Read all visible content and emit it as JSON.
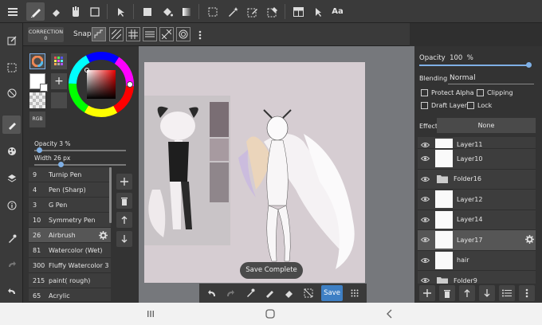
{
  "topbar": {
    "text_tool_label": "Aa"
  },
  "subbar": {
    "correction_label": "CORRECTION",
    "correction_value": "0",
    "snap_label": "Snap"
  },
  "leftpanel": {
    "rgb_label": "RGB",
    "opacity_label": "Opacity",
    "opacity_value": "3",
    "opacity_unit": "%",
    "opacity_fraction": 0.03,
    "width_label": "Width",
    "width_value": "26",
    "width_unit": "px",
    "width_fraction": 0.26,
    "brushes": [
      {
        "size": "9",
        "name": "Turnip Pen"
      },
      {
        "size": "4",
        "name": "Pen (Sharp)"
      },
      {
        "size": "3",
        "name": "G Pen"
      },
      {
        "size": "10",
        "name": "Symmetry Pen"
      },
      {
        "size": "26",
        "name": "Airbrush",
        "selected": true
      },
      {
        "size": "81",
        "name": "Watercolor (Wet)"
      },
      {
        "size": "300",
        "name": "Fluffy Watercolor 3"
      },
      {
        "size": "215",
        "name": "paint( rough)"
      },
      {
        "size": "65",
        "name": "Acrylic"
      }
    ]
  },
  "canvas": {
    "toast": "Save Complete",
    "save_label": "Save"
  },
  "rightpanel": {
    "opacity_label": "Opacity",
    "opacity_value": "100",
    "opacity_unit": "%",
    "blending_label": "Blending",
    "blending_value": "Normal",
    "protect_alpha": "Protect Alpha",
    "clipping": "Clipping",
    "draft_layer": "Draft Layer",
    "lock": "Lock",
    "effect_label": "Effect",
    "effect_value": "None",
    "layers": [
      {
        "name": "Layer11",
        "type": "layer",
        "partial": true
      },
      {
        "name": "Layer10",
        "type": "layer"
      },
      {
        "name": "Folder16",
        "type": "folder"
      },
      {
        "name": "Layer12",
        "type": "layer"
      },
      {
        "name": "Layer14",
        "type": "layer"
      },
      {
        "name": "Layer17",
        "type": "layer",
        "selected": true
      },
      {
        "name": "hair",
        "type": "layer"
      },
      {
        "name": "Folder9",
        "type": "folder"
      }
    ]
  },
  "colors": {
    "accent": "#3e7fc4",
    "primary_swatch": "#ffffff",
    "canvas_bg": "#d6cdd2"
  }
}
